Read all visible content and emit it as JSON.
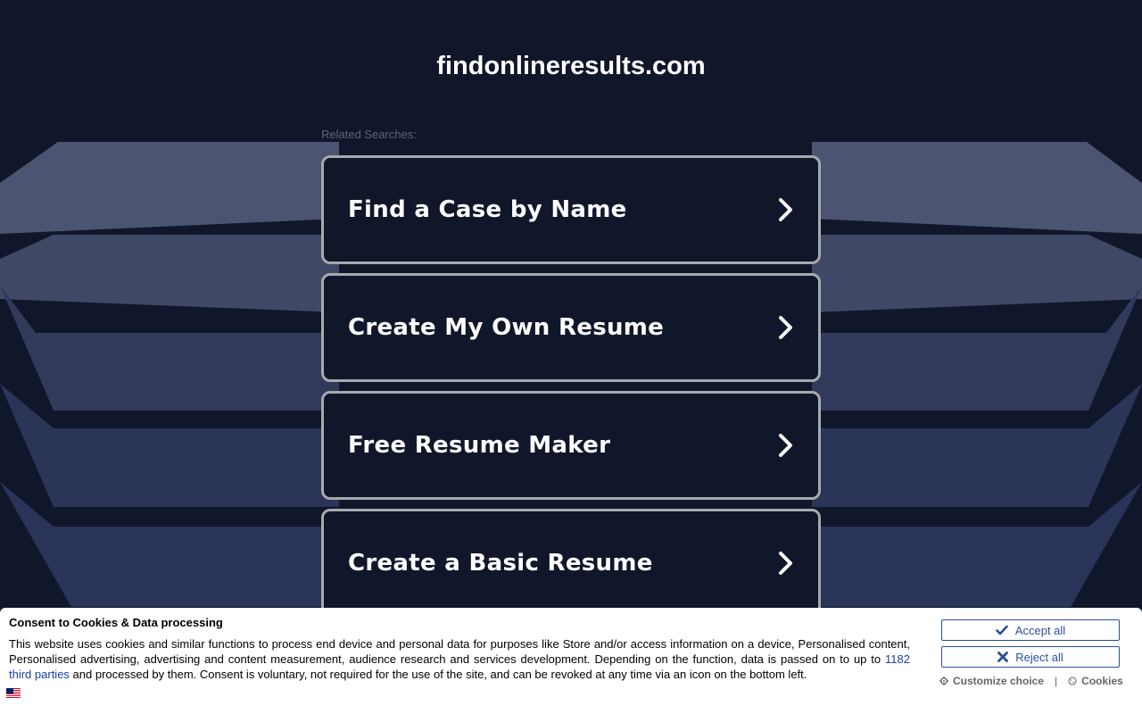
{
  "header": {
    "site_title": "findonlineresults.com"
  },
  "related": {
    "label": "Related Searches:",
    "items": [
      {
        "label": "Find a Case by Name"
      },
      {
        "label": "Create My Own Resume"
      },
      {
        "label": "Free Resume Maker"
      },
      {
        "label": "Create a Basic Resume"
      }
    ]
  },
  "consent": {
    "title": "Consent to Cookies & Data processing",
    "text_before": "This website uses cookies and similar functions to process end device and personal data for purposes like Store and/or access information on a device, Personalised content, Personalised advertising, advertising and content measurement, audience research and services development. Depending on the function, data is passed on to up to ",
    "third_parties_link": "1182 third parties",
    "text_after": " and processed by them. Consent is voluntary, not required for the use of the site, and can be revoked at any time via an icon on the bottom left.",
    "accept_label": "Accept all",
    "reject_label": "Reject all",
    "customize_label": "Customize choice",
    "separator": "|",
    "cookies_label": "Cookies"
  },
  "colors": {
    "background": "#11172b",
    "card_border": "#a7a9ad",
    "consent_button": "#2b4f9c"
  },
  "icons": {
    "card_chevron": "chevron-right-icon",
    "accept": "check-icon",
    "reject": "x-icon",
    "customize": "gear-icon",
    "cookies": "cookie-icon",
    "language": "flag-uk-icon"
  }
}
